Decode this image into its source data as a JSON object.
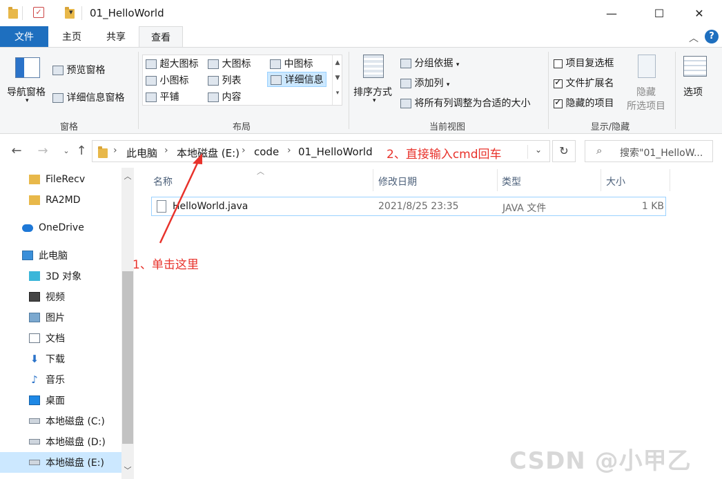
{
  "window": {
    "title": "01_HelloWorld",
    "minimize": "—",
    "maximize": "☐",
    "close": "✕"
  },
  "tabs": {
    "file": "文件",
    "home": "主页",
    "share": "共享",
    "view": "查看"
  },
  "ribbon": {
    "panes": {
      "nav_pane": "导航窗格",
      "preview_pane": "预览窗格",
      "details_pane": "详细信息窗格",
      "label": "窗格"
    },
    "layout": {
      "xl_icons": "超大图标",
      "large_icons": "大图标",
      "medium_icons": "中图标",
      "small_icons": "小图标",
      "list": "列表",
      "details": "详细信息",
      "tiles": "平铺",
      "content": "内容",
      "label": "布局"
    },
    "current_view": {
      "sort_by": "排序方式",
      "group_by": "分组依据",
      "add_columns": "添加列",
      "fit_columns": "将所有列调整为合适的大小",
      "label": "当前视图"
    },
    "show_hide": {
      "item_checkboxes": "项目复选框",
      "item_checkboxes_checked": false,
      "file_extensions": "文件扩展名",
      "file_extensions_checked": true,
      "hidden_items": "隐藏的项目",
      "hidden_items_checked": true,
      "hide_selected_1": "隐藏",
      "hide_selected_2": "所选项目",
      "label": "显示/隐藏"
    },
    "options": "选项"
  },
  "address": {
    "crumbs": [
      "此电脑",
      "本地磁盘 (E:)",
      "code",
      "01_HelloWorld"
    ],
    "search_placeholder": "搜索\"01_HelloW..."
  },
  "sidebar": {
    "items": [
      {
        "label": "FileRecv",
        "icon": "folder-icon"
      },
      {
        "label": "RA2MD",
        "icon": "folder-icon"
      },
      {
        "label": "OneDrive",
        "icon": "cloud-icon"
      },
      {
        "label": "此电脑",
        "icon": "pc-icon"
      },
      {
        "label": "3D 对象",
        "icon": "cube-icon"
      },
      {
        "label": "视频",
        "icon": "video-icon"
      },
      {
        "label": "图片",
        "icon": "picture-icon"
      },
      {
        "label": "文档",
        "icon": "document-icon"
      },
      {
        "label": "下载",
        "icon": "download-icon"
      },
      {
        "label": "音乐",
        "icon": "music-icon"
      },
      {
        "label": "桌面",
        "icon": "desktop-icon"
      },
      {
        "label": "本地磁盘 (C:)",
        "icon": "drive-icon"
      },
      {
        "label": "本地磁盘 (D:)",
        "icon": "drive-icon"
      },
      {
        "label": "本地磁盘 (E:)",
        "icon": "drive-icon"
      }
    ]
  },
  "columns": {
    "name": "名称",
    "modified": "修改日期",
    "type": "类型",
    "size": "大小"
  },
  "files": [
    {
      "name": "HelloWorld.java",
      "modified": "2021/8/25 23:35",
      "type": "JAVA 文件",
      "size": "1 KB"
    }
  ],
  "annotations": {
    "step1": "1、单击这里",
    "step2": "2、直接输入cmd回车"
  },
  "watermark": "CSDN @小甲乙",
  "colors": {
    "accent": "#1e6fbf",
    "annotation": "#e8322b",
    "selection": "#cce8ff"
  }
}
